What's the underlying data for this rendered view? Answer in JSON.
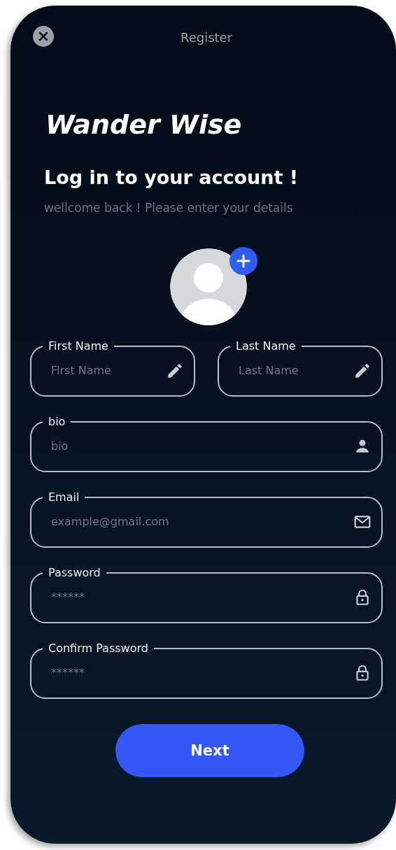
{
  "header": {
    "title": "Register"
  },
  "brand": "Wander Wise",
  "heading": "Log in to your account !",
  "subtitle": "wellcome back ! Please enter your details",
  "field_rows": [
    [
      {
        "label": "First Name",
        "placeholder": "First Name",
        "kind": "pencil"
      },
      {
        "label": "Last Name",
        "placeholder": "Last Name",
        "kind": "pencil"
      }
    ],
    [
      {
        "label": "bio",
        "placeholder": "bio",
        "kind": "person"
      }
    ],
    [
      {
        "label": "Email",
        "placeholder": "example@gmail.com",
        "kind": "mail"
      }
    ],
    [
      {
        "label": "Password",
        "placeholder": "******",
        "kind": "lock"
      }
    ],
    [
      {
        "label": "Confirm Password",
        "placeholder": "******",
        "kind": "lock"
      }
    ]
  ],
  "button": "Next"
}
